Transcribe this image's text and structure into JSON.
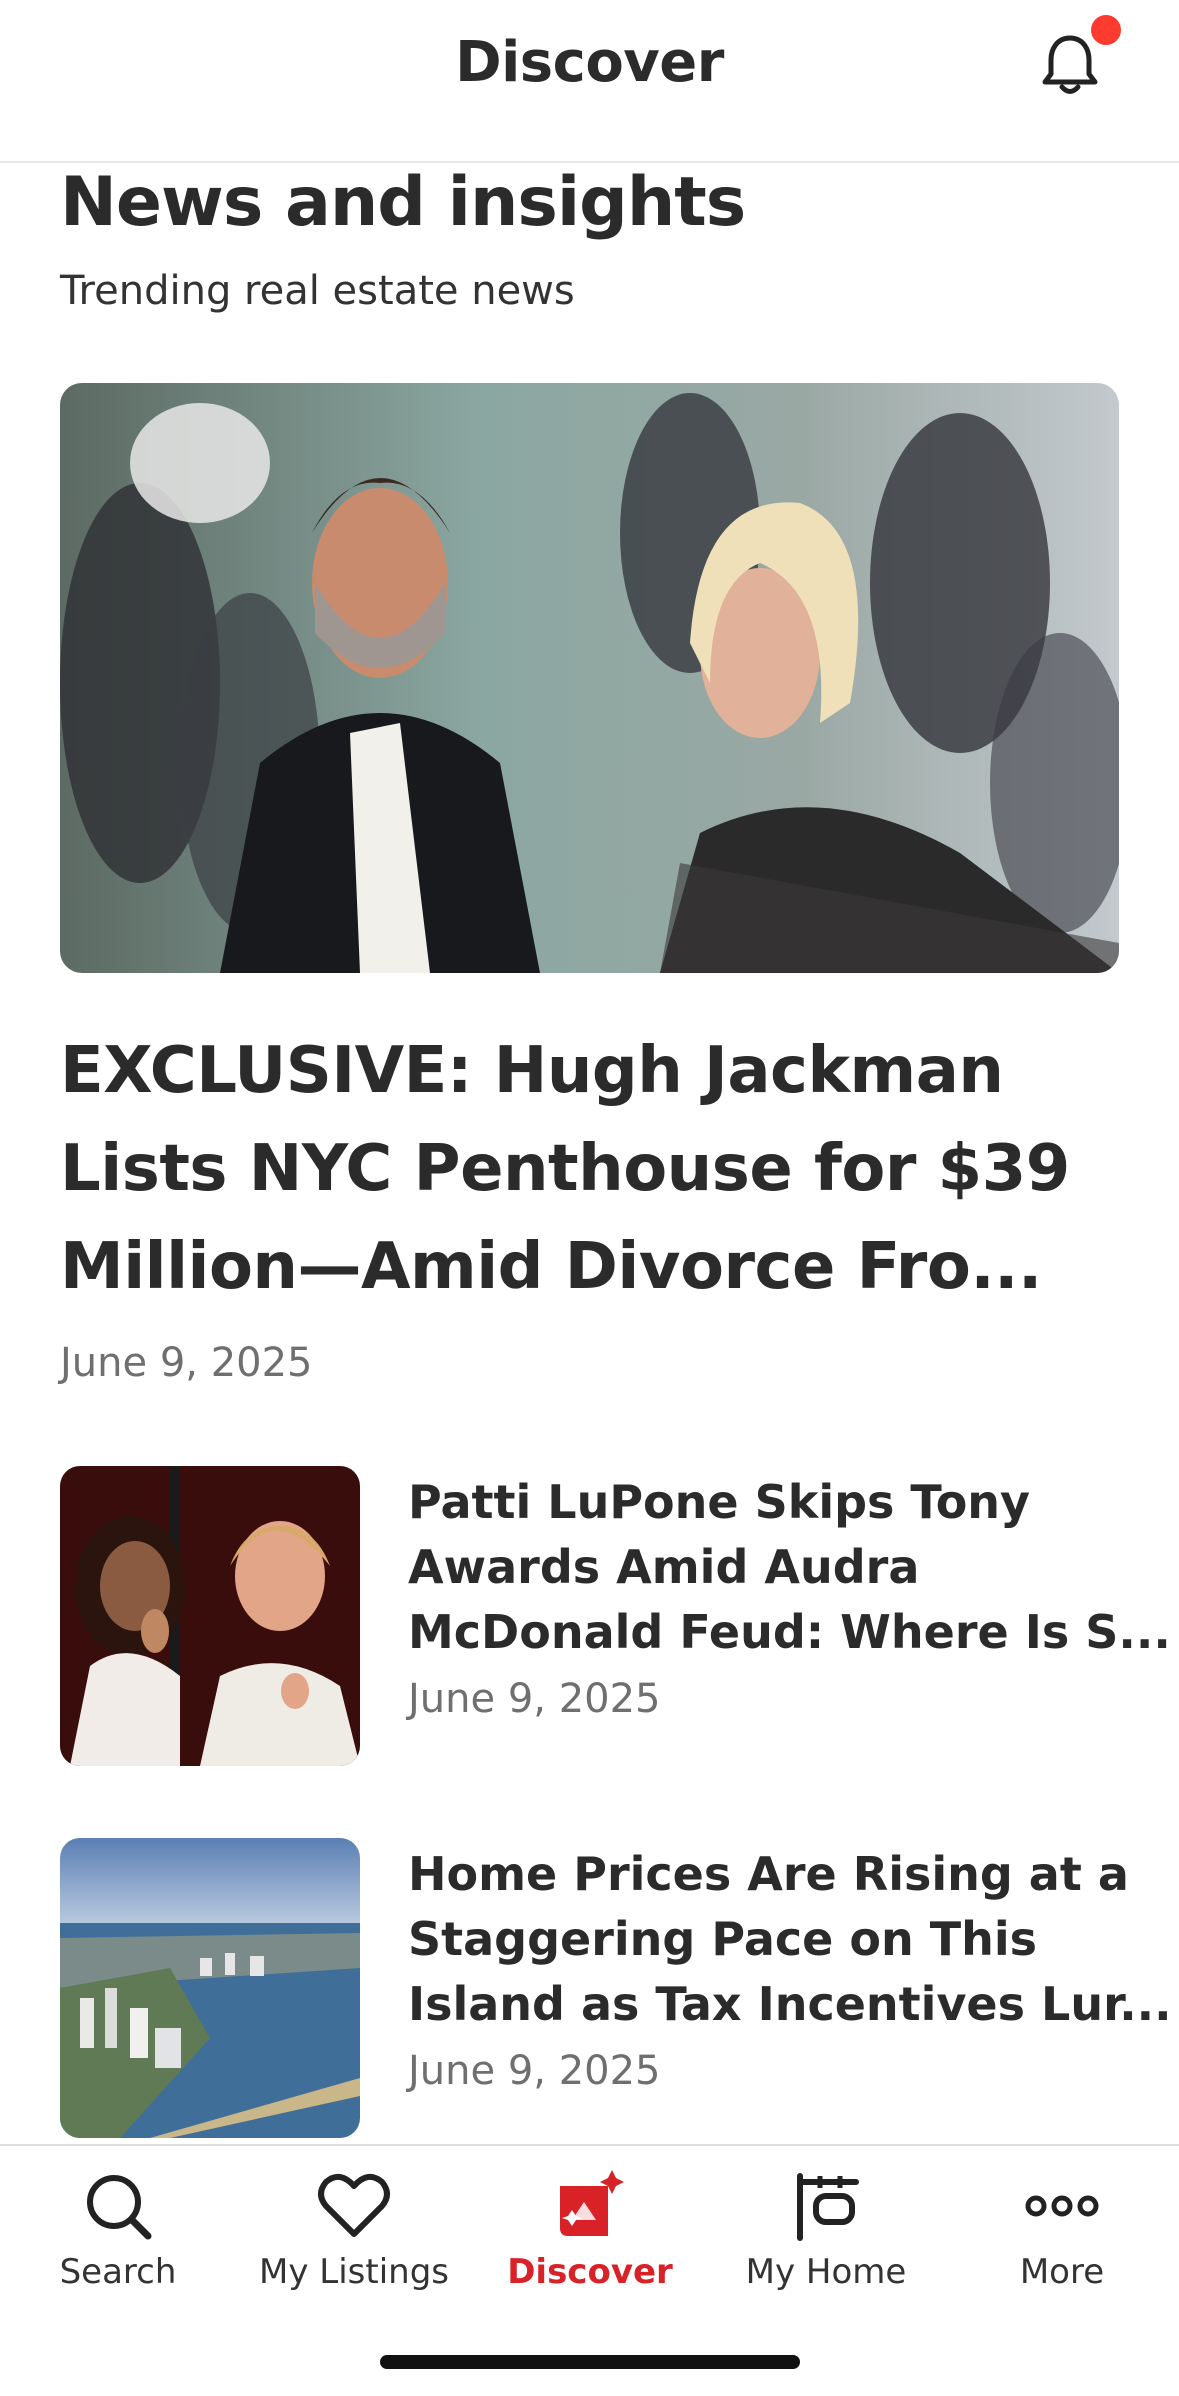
{
  "header": {
    "title": "Discover",
    "notification_icon": "bell-icon",
    "badge_color": "#ff3b30"
  },
  "section": {
    "title": "News and insights",
    "subtitle": "Trending real estate news"
  },
  "featured": {
    "image": "photo-couple-red-carpet",
    "title": "EXCLUSIVE: Hugh Jackman Lists NYC Penthouse for $39 Million—Amid Divorce Fro...",
    "date": "June 9, 2025"
  },
  "articles": [
    {
      "image": "photo-two-performers-singing",
      "title": "Patti LuPone Skips Tony Awards Amid Audra McDonald Feud: Where Is S...",
      "date": "June 9, 2025"
    },
    {
      "image": "photo-island-coastline-city",
      "title": "Home Prices Are Rising at a Staggering Pace on This Island as Tax Incentives Lur...",
      "date": "June 9, 2025"
    }
  ],
  "tabs": [
    {
      "label": "Search",
      "icon": "search-icon",
      "active": false
    },
    {
      "label": "My Listings",
      "icon": "heart-icon",
      "active": false
    },
    {
      "label": "Discover",
      "icon": "discover-icon",
      "active": true
    },
    {
      "label": "My Home",
      "icon": "home-sign-icon",
      "active": false
    },
    {
      "label": "More",
      "icon": "more-dots-icon",
      "active": false
    }
  ],
  "colors": {
    "accent": "#d92228",
    "text": "#2b2b2b",
    "muted": "#6f6f6f"
  }
}
